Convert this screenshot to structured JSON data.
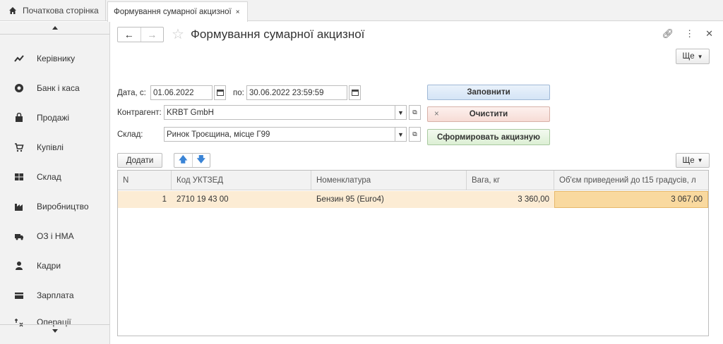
{
  "tabs": {
    "home_label": "Початкова сторінка",
    "doc_label": "Формування сумарної акцизної",
    "close_symbol": "×"
  },
  "sidebar": {
    "items": [
      {
        "label": "Керівнику",
        "icon": "trend-chart-icon"
      },
      {
        "label": "Банк і каса",
        "icon": "bank-icon"
      },
      {
        "label": "Продажі",
        "icon": "shopping-bag-icon"
      },
      {
        "label": "Купівлі",
        "icon": "cart-icon"
      },
      {
        "label": "Склад",
        "icon": "warehouse-icon"
      },
      {
        "label": "Виробництво",
        "icon": "factory-icon"
      },
      {
        "label": "ОЗ і НМА",
        "icon": "truck-icon"
      },
      {
        "label": "Кадри",
        "icon": "person-icon"
      },
      {
        "label": "Зарплата",
        "icon": "wallet-icon"
      },
      {
        "label": "Операції",
        "icon": "operations-icon"
      }
    ]
  },
  "header": {
    "title": "Формування сумарної акцизної",
    "more_label": "Ще"
  },
  "form": {
    "date_from_label": "Дата, с:",
    "date_from_value": "01.06.2022",
    "date_to_label": "по:",
    "date_to_value": "30.06.2022 23:59:59",
    "counterparty_label": "Контрагент:",
    "counterparty_value": "KRBT GmbH",
    "warehouse_label": "Склад:",
    "warehouse_value": "Ринок Троєщина, місце Г99",
    "fill_label": "Заповнити",
    "clear_label": "Очистити",
    "clear_symbol": "×",
    "generate_label": "Сформировать акцизную"
  },
  "table": {
    "add_label": "Додати",
    "more_label": "Ще",
    "columns": [
      "N",
      "Код УКТЗЕД",
      "Номенклатура",
      "Вага, кг",
      "Об'єм приведений до t15 градусів, л"
    ],
    "rows": [
      {
        "n": "1",
        "code": "2710 19 43 00",
        "item": "Бензин 95 (Euro4)",
        "weight": "3 360,00",
        "volume": "3 067,00"
      }
    ]
  },
  "colors": {
    "row_highlight": "#fcecd4",
    "cell_selected": "#f9d99f",
    "arrow_blue": "#3a84d6"
  }
}
